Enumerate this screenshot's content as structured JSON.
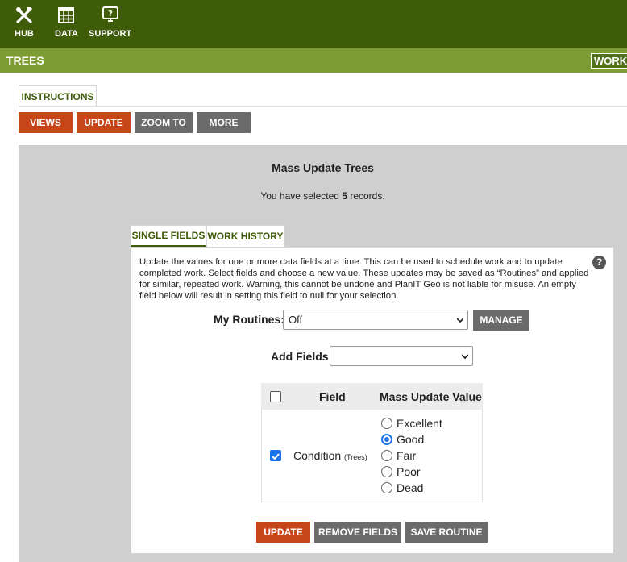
{
  "nav": {
    "items": [
      {
        "label": "HUB",
        "icon": "tools-icon"
      },
      {
        "label": "DATA",
        "icon": "table-icon"
      },
      {
        "label": "SUPPORT",
        "icon": "help-screen-icon"
      }
    ]
  },
  "section": {
    "title": "TREES",
    "work_label": "WORK"
  },
  "tabs": {
    "instructions": "INSTRUCTIONS"
  },
  "toolbar": {
    "views": "VIEWS",
    "update": "UPDATE",
    "zoom_to": "ZOOM TO",
    "more": "MORE"
  },
  "mass_update": {
    "title": "Mass Update Trees",
    "selected_prefix": "You have selected ",
    "selected_count": "5",
    "selected_suffix": " records.",
    "tabs": [
      "SINGLE FIELDS",
      "WORK HISTORY"
    ],
    "description": "Update the values for one or more data fields at a time. This can be used to schedule work and to update completed work. Select fields and choose a new value. These updates may be saved as “Routines” and applied for similar, repeated work. Warning, this cannot be undone and PlanIT Geo is not liable for misuse. An empty field below will result in setting this field to null for your selection.",
    "help": "?",
    "routines_label": "My Routines:",
    "routines_value": "Off",
    "manage_label": "MANAGE",
    "add_fields_label": "Add Fields",
    "add_fields_value": "",
    "table": {
      "headers": [
        "Field",
        "Mass Update Value"
      ],
      "row": {
        "field": "Condition",
        "field_qualifier": "(Trees)",
        "checked": true,
        "options": [
          "Excellent",
          "Good",
          "Fair",
          "Poor",
          "Dead"
        ],
        "selected": "Good"
      }
    },
    "buttons": {
      "update": "UPDATE",
      "remove_fields": "REMOVE FIELDS",
      "save_routine": "SAVE ROUTINE"
    }
  },
  "colors": {
    "nav_bg": "#3f5c08",
    "section_bg": "#7d9c33",
    "orange": "#c6461a",
    "gray_btn": "#6b6b6b",
    "panel_bg": "#cfcfcf",
    "radio_blue": "#1a73e8"
  }
}
